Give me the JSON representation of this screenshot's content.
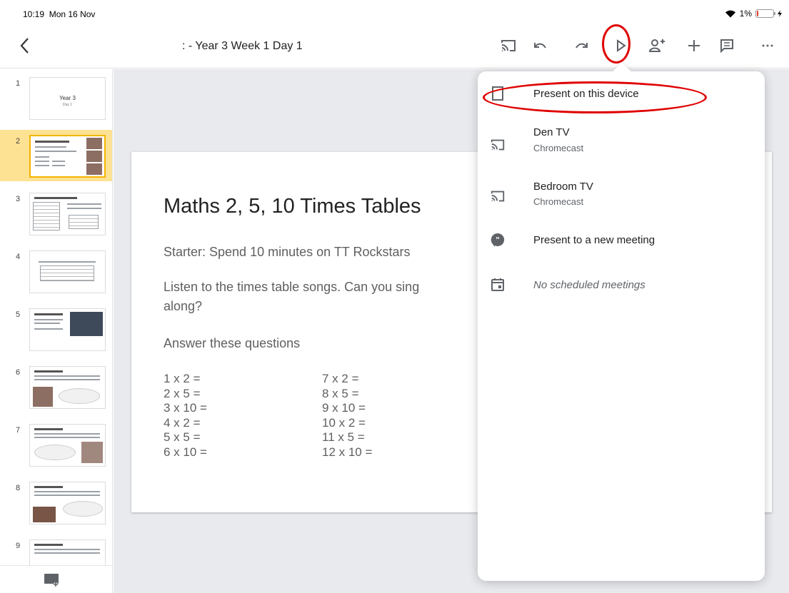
{
  "status": {
    "time": "10:19",
    "date": "Mon 16 Nov",
    "battery": "1%"
  },
  "toolbar": {
    "title": ": - Year 3 Week 1 Day 1"
  },
  "sidebar": {
    "slides": [
      {
        "number": "1",
        "title": "Year 3",
        "subtitle": "Day 1"
      },
      {
        "number": "2"
      },
      {
        "number": "3"
      },
      {
        "number": "4"
      },
      {
        "number": "5"
      },
      {
        "number": "6"
      },
      {
        "number": "7"
      },
      {
        "number": "8"
      },
      {
        "number": "9"
      }
    ]
  },
  "slide": {
    "title": "Maths 2, 5, 10 Times Tables",
    "starter": "Starter: Spend 10 minutes on TT Rockstars",
    "listen_line1": "Listen to the times table songs. Can you sing",
    "listen_line2": "along?",
    "answer": "Answer these questions",
    "col1": [
      "1 x 2 =",
      "2 x 5 =",
      "3 x 10 =",
      "4 x 2 =",
      "5 x 5 =",
      "6 x 10 ="
    ],
    "col2": [
      "7 x 2 =",
      "8 x 5 =",
      "9 x 10 =",
      "10 x 2 =",
      "11 x 5 =",
      "12 x 10 ="
    ]
  },
  "menu": {
    "present_device": "Present on this device",
    "den_tv": "Den TV",
    "den_tv_sub": "Chromecast",
    "bedroom_tv": "Bedroom TV",
    "bedroom_tv_sub": "Chromecast",
    "new_meeting": "Present to a new meeting",
    "no_meetings": "No scheduled meetings"
  }
}
